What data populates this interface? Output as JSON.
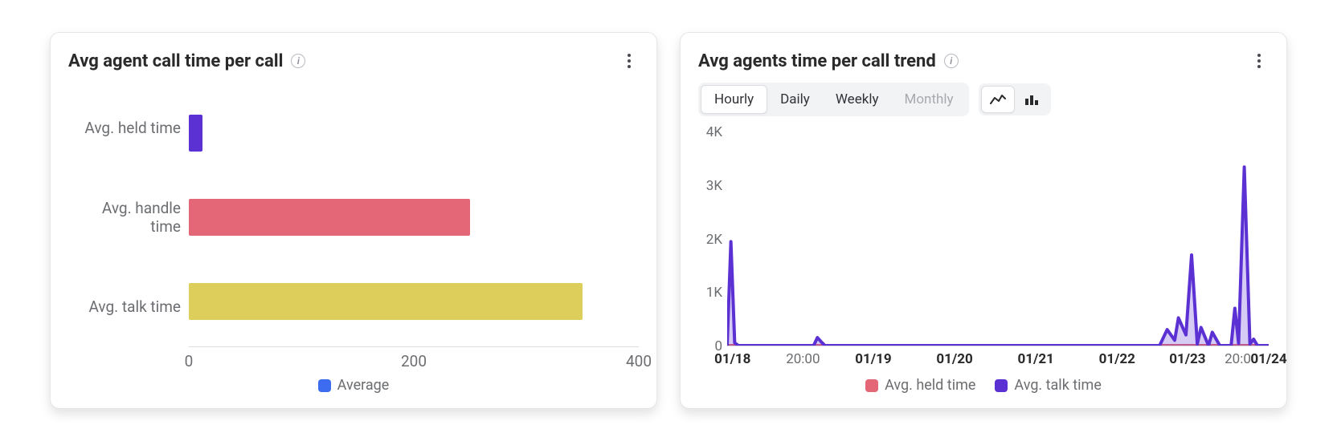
{
  "chart_data": [
    {
      "type": "bar",
      "orientation": "horizontal",
      "title": "Avg agent call time per call",
      "categories": [
        "Avg. held time",
        "Avg. handle time",
        "Avg. talk time"
      ],
      "values": [
        12,
        250,
        350
      ],
      "colors": [
        "#5b31d3",
        "#e46777",
        "#ddce5c"
      ],
      "xlim": [
        0,
        400
      ],
      "x_ticks": [
        0,
        200,
        400
      ],
      "legend": [
        {
          "label": "Average",
          "color": "#3d6cf0"
        }
      ]
    },
    {
      "type": "line",
      "title": "Avg agents time per call trend",
      "ylim": [
        0,
        4000
      ],
      "y_ticks": [
        0,
        1000,
        2000,
        3000,
        4000
      ],
      "y_tick_labels": [
        "0",
        "1K",
        "2K",
        "3K",
        "4K"
      ],
      "x_tick_labels": [
        "01/18",
        "20:00",
        "01/19",
        "01/20",
        "01/21",
        "01/22",
        "01/23",
        "20:00",
        "01/24"
      ],
      "x_tick_bold": [
        true,
        false,
        true,
        true,
        true,
        true,
        true,
        false,
        true
      ],
      "x_tick_pos_pct": [
        1,
        14,
        27,
        42,
        57,
        72,
        85,
        95,
        100
      ],
      "x_range_hours": [
        0,
        144
      ],
      "series": [
        {
          "name": "Avg. held time",
          "color": "#e46777",
          "x": [
            0,
            144
          ],
          "y": [
            0,
            0
          ]
        },
        {
          "name": "Avg. talk time",
          "color": "#5b31d3",
          "x": [
            0,
            1,
            2,
            3,
            23,
            24,
            25,
            26,
            115,
            117,
            119,
            120,
            122,
            123.5,
            125,
            126,
            128,
            129,
            131,
            134,
            135,
            136,
            137.5,
            139,
            140,
            141,
            144
          ],
          "y": [
            0,
            1950,
            50,
            0,
            0,
            150,
            70,
            0,
            0,
            300,
            100,
            520,
            200,
            1700,
            30,
            340,
            0,
            250,
            0,
            0,
            700,
            40,
            3350,
            30,
            120,
            0,
            0
          ]
        }
      ],
      "controls": {
        "freq": {
          "options": [
            "Hourly",
            "Daily",
            "Weekly",
            "Monthly"
          ],
          "active": "Hourly",
          "disabled": [
            "Monthly"
          ]
        },
        "charttype": {
          "options": [
            "line",
            "bar"
          ],
          "active": "line"
        }
      },
      "legend": [
        {
          "label": "Avg. held time",
          "color": "#e46777"
        },
        {
          "label": "Avg. talk time",
          "color": "#5b31d3"
        }
      ]
    }
  ],
  "left_card": {
    "title": "Avg agent call time per call",
    "categories": [
      "Avg. held time",
      "Avg. handle time",
      "Avg. talk time"
    ],
    "x_tick_labels": [
      "0",
      "200",
      "400"
    ],
    "legend_label": "Average"
  },
  "right_card": {
    "title": "Avg agents time per call trend",
    "freq": {
      "hourly": "Hourly",
      "daily": "Daily",
      "weekly": "Weekly",
      "monthly": "Monthly"
    },
    "legend": {
      "held": "Avg. held time",
      "talk": "Avg. talk time"
    }
  }
}
